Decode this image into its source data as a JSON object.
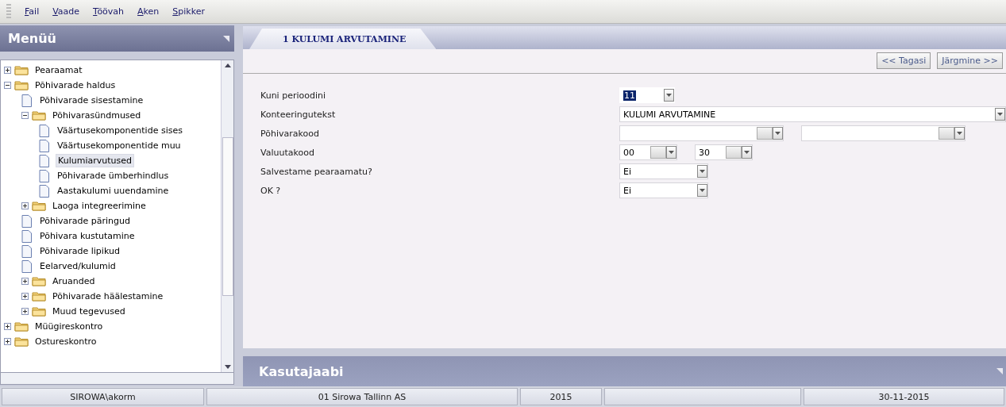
{
  "menu_bar": [
    {
      "label": "Fail"
    },
    {
      "label": "Vaade"
    },
    {
      "label": "Töövah"
    },
    {
      "label": "Aken"
    },
    {
      "label": "Spikker"
    }
  ],
  "sidebar": {
    "title": "Menüü",
    "items": [
      {
        "label": "Pearaamat",
        "kind": "folder",
        "expanded": false
      },
      {
        "label": "Põhivarade haldus",
        "kind": "folder",
        "expanded": true,
        "children": [
          {
            "label": "Põhivarade sisestamine",
            "kind": "page",
            "selected": false
          },
          {
            "label": "Põhivarasündmused",
            "kind": "folder",
            "expanded": true,
            "children": [
              {
                "label": "Väärtusekomponentide sises",
                "kind": "page",
                "selected": false
              },
              {
                "label": "Väärtusekomponentide muu",
                "kind": "page",
                "selected": false
              },
              {
                "label": "Kulumiarvutused",
                "kind": "page",
                "selected": true
              },
              {
                "label": "Põhivarade ümberhindlus",
                "kind": "page",
                "selected": false
              },
              {
                "label": "Aastakulumi uuendamine",
                "kind": "page",
                "selected": false
              }
            ]
          },
          {
            "label": "Laoga integreerimine",
            "kind": "folder",
            "expanded": false
          },
          {
            "label": "Põhivarade päringud",
            "kind": "page",
            "selected": false
          },
          {
            "label": "Põhivara kustutamine",
            "kind": "page",
            "selected": false
          },
          {
            "label": "Põhivarade lipikud",
            "kind": "page",
            "selected": false
          },
          {
            "label": "Eelarved/kulumid",
            "kind": "page",
            "selected": false
          },
          {
            "label": "Aruanded",
            "kind": "folder",
            "expanded": false
          },
          {
            "label": "Põhivarade häälestamine",
            "kind": "folder",
            "expanded": false
          },
          {
            "label": "Muud tegevused",
            "kind": "folder",
            "expanded": false
          }
        ]
      },
      {
        "label": "Müügireskontro",
        "kind": "folder",
        "expanded": false
      },
      {
        "label": "Ostureskontro",
        "kind": "folder",
        "expanded": false
      }
    ]
  },
  "tabs": [
    {
      "label": "1 KULUMI ARVUTAMINE",
      "selected": true
    }
  ],
  "nav_buttons": [
    {
      "label": "<< Tagasi"
    },
    {
      "label": "Järgmine >>"
    }
  ],
  "form": [
    {
      "label": "Kuni perioodini",
      "fields": [
        {
          "kind": "period",
          "value": "11",
          "selected": true
        }
      ]
    },
    {
      "label": "Konteeringutekst",
      "fields": [
        {
          "kind": "wide",
          "value": "KULUMI ARVUTAMINE"
        }
      ]
    },
    {
      "label": "Põhivarakood",
      "fields": [
        {
          "kind": "lookup"
        },
        {
          "kind": "lookup"
        }
      ]
    },
    {
      "label": "Valuutakood",
      "fields": [
        {
          "kind": "small-lookup",
          "value": "00"
        },
        {
          "kind": "small-lookup",
          "value": "30"
        }
      ]
    },
    {
      "label": "Salvestame pearaamatu?",
      "fields": [
        {
          "kind": "combo",
          "value": "Ei"
        }
      ]
    },
    {
      "label": "OK ?",
      "fields": [
        {
          "kind": "combo",
          "value": "Ei"
        }
      ]
    }
  ],
  "help_panel": {
    "title": "Kasutajaabi"
  },
  "status_bar": [
    {
      "kind": "text",
      "text": "SIROWA\\akorm"
    },
    {
      "kind": "text",
      "text": "01 Sirowa Tallinn AS"
    },
    {
      "kind": "text",
      "text": "2015"
    },
    {
      "kind": "blank"
    },
    {
      "kind": "text",
      "text": "30-11-2015"
    }
  ]
}
